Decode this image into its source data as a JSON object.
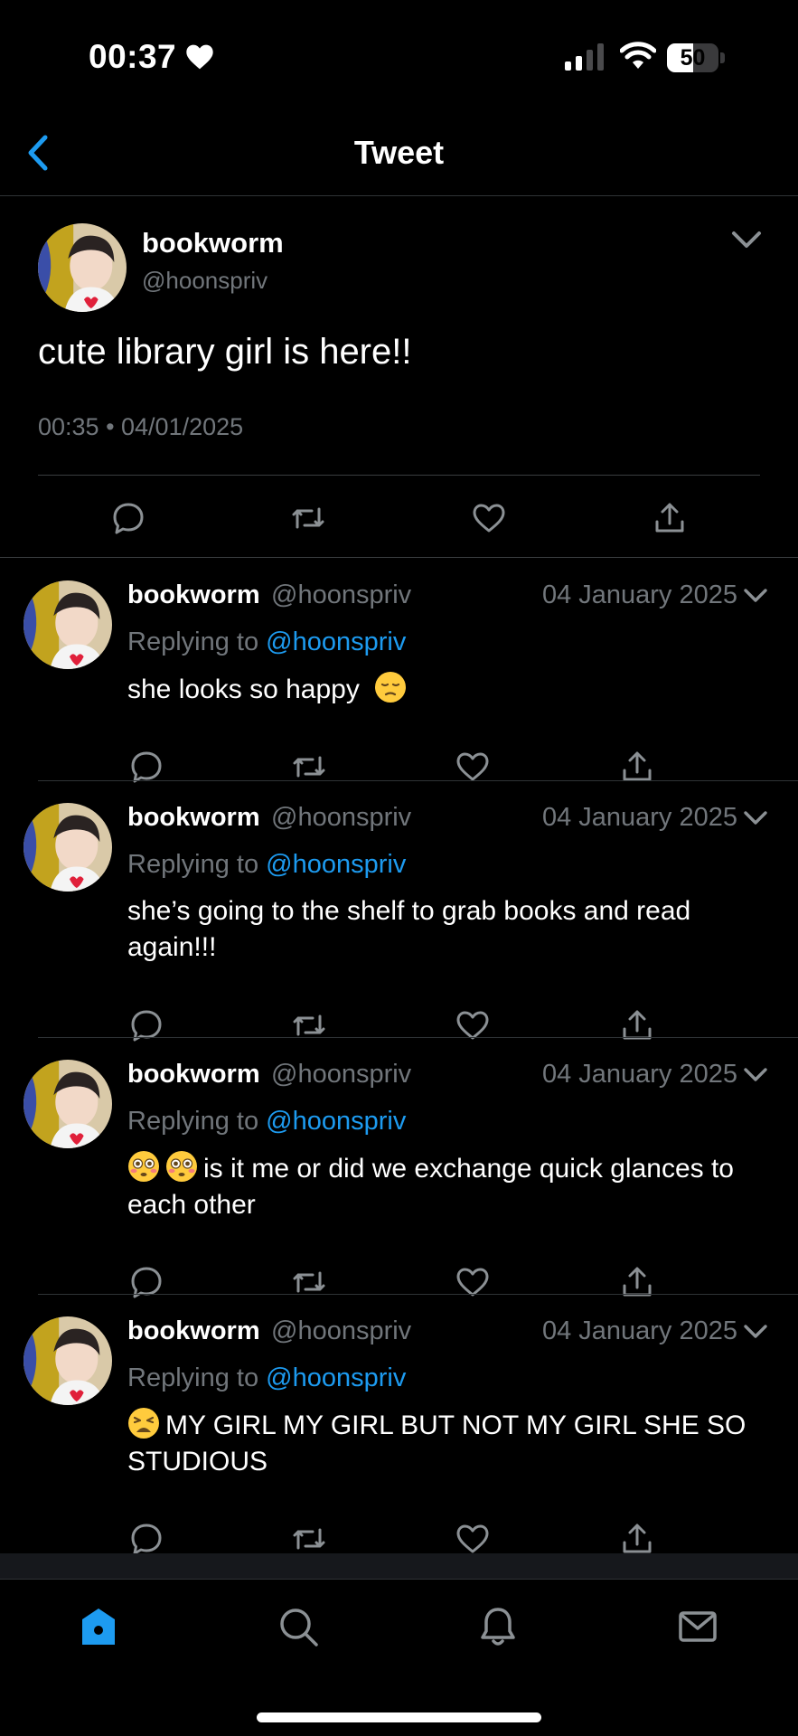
{
  "status_bar": {
    "time": "00:37",
    "battery_level": "50",
    "battery_fraction": 0.5,
    "icons": [
      "heart-icon",
      "signal-icon",
      "wifi-icon",
      "battery-icon"
    ]
  },
  "header": {
    "title": "Tweet",
    "back_icon": "chevron-left-icon"
  },
  "main_tweet": {
    "name": "bookworm",
    "handle": "@hoonspriv",
    "text": "cute library girl is here!!",
    "timestamp": "00:35 • 04/01/2025",
    "actions": [
      "reply-icon",
      "retweet-icon",
      "like-icon",
      "share-icon"
    ]
  },
  "replies": [
    {
      "name": "bookworm",
      "handle": "@hoonspriv",
      "date": "04 January 2025",
      "replying_prefix": "Replying to",
      "replying_to": "@hoonspriv",
      "emoji_before": [],
      "text": "she looks so happy",
      "emoji_after": [
        "pensive-face"
      ]
    },
    {
      "name": "bookworm",
      "handle": "@hoonspriv",
      "date": "04 January 2025",
      "replying_prefix": "Replying to",
      "replying_to": "@hoonspriv",
      "emoji_before": [],
      "text": "she’s going to the shelf to grab books and read again!!!",
      "emoji_after": []
    },
    {
      "name": "bookworm",
      "handle": "@hoonspriv",
      "date": "04 January 2025",
      "replying_prefix": "Replying to",
      "replying_to": "@hoonspriv",
      "emoji_before": [
        "flushed-face",
        "flushed-face"
      ],
      "text": "is it me or did we exchange quick glances to each other",
      "emoji_after": []
    },
    {
      "name": "bookworm",
      "handle": "@hoonspriv",
      "date": "04 January 2025",
      "replying_prefix": "Replying to",
      "replying_to": "@hoonspriv",
      "emoji_before": [
        "weary-face"
      ],
      "text": "MY GIRL MY GIRL BUT NOT MY GIRL SHE SO STUDIOUS",
      "emoji_after": []
    }
  ],
  "tab_bar": {
    "tabs": [
      "home-icon",
      "search-icon",
      "notifications-icon",
      "messages-icon"
    ],
    "active": "home-icon"
  },
  "colors": {
    "background": "#000000",
    "accent": "#1d9bf0",
    "secondary_text": "#71767b"
  }
}
